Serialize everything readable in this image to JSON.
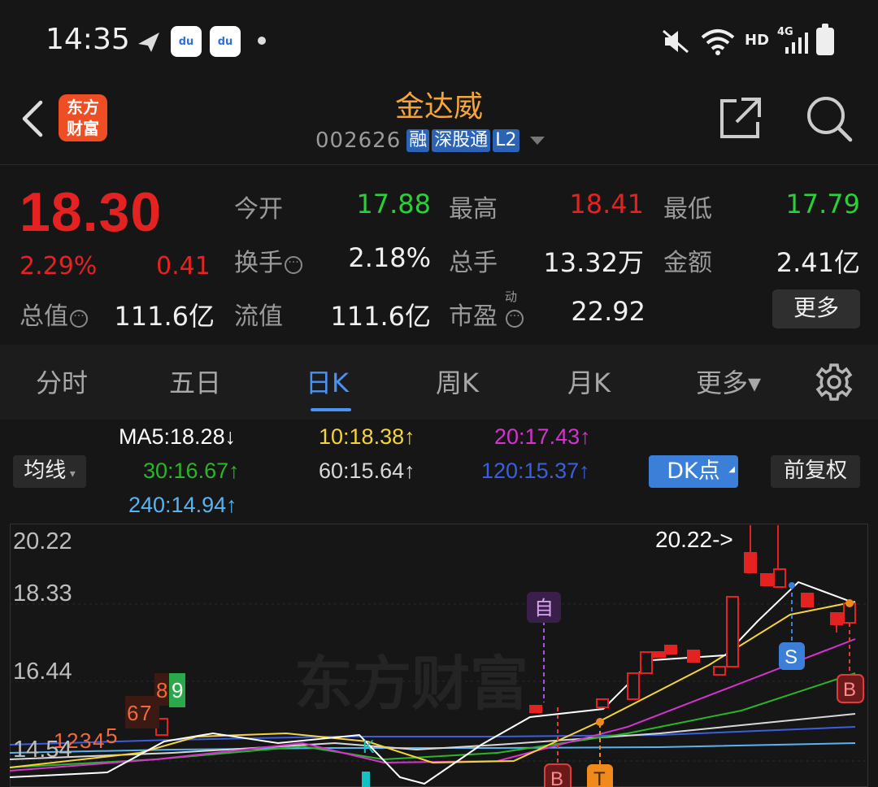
{
  "status_bar": {
    "time": "14:35",
    "network": "4G",
    "hd": "HD"
  },
  "header": {
    "app_logo_text_1": "东方",
    "app_logo_text_2": "财富",
    "stock_name": "金达威",
    "stock_code": "002626",
    "tags": [
      "融",
      "深股通",
      "L2"
    ]
  },
  "quote": {
    "price": "18.30",
    "change_pct": "2.29%",
    "change": "0.41",
    "rows": [
      [
        {
          "label": "今开",
          "value": "17.88",
          "color": "green"
        },
        {
          "label": "最高",
          "value": "18.41",
          "color": "red"
        },
        {
          "label": "最低",
          "value": "17.79",
          "color": "green"
        }
      ],
      [
        {
          "label": "换手",
          "value": "2.18%",
          "color": "white"
        },
        {
          "label": "总手",
          "value": "13.32万",
          "color": "white"
        },
        {
          "label": "金额",
          "value": "2.41亿",
          "color": "white"
        }
      ]
    ],
    "total_value_label": "总值",
    "total_value": "111.6亿",
    "float_value_label": "流值",
    "float_value": "111.6亿",
    "pe_label": "市盈",
    "pe_superscript": "动",
    "pe_value": "22.92",
    "more_label": "更多"
  },
  "tabs": [
    "分时",
    "五日",
    "日K",
    "周K",
    "月K",
    "更多▾"
  ],
  "active_tab": "日K",
  "ma_legend": {
    "type_button": "均线",
    "ma5": "MA5:18.28↓",
    "ma10": "10:18.38↑",
    "ma20": "20:17.43↑",
    "ma30": "30:16.67↑",
    "ma60": "60:15.64↑",
    "ma120": "120:15.37↑",
    "ma240": "240:14.94↑",
    "dk_button": "DK点",
    "adjust_button": "前复权",
    "colors": {
      "ma5": "#ffffff",
      "ma10": "#f5d33a",
      "ma20": "#d532d0",
      "ma30": "#2bb52b",
      "ma60": "#d8d8d8",
      "ma120": "#3b5ee0",
      "ma240": "#58b4f0"
    }
  },
  "chart_data": {
    "type": "candlestick",
    "y_ticks": [
      "20.22",
      "18.33",
      "16.44",
      "14.54"
    ],
    "max_label": "20.22->",
    "watermark": "东方财富",
    "signals": [
      "自",
      "S",
      "B",
      "B",
      "T"
    ],
    "sequence_labels": [
      "1",
      "2",
      "3",
      "4",
      "5",
      "6",
      "7",
      "8",
      "9"
    ],
    "k_marker": "K",
    "colors": {
      "up": "#e52222",
      "down": "#13c2c2",
      "zi": "#b14fe0",
      "s": "#3b7fd8",
      "b": "#e03b3b",
      "t": "#f08a1a"
    }
  }
}
